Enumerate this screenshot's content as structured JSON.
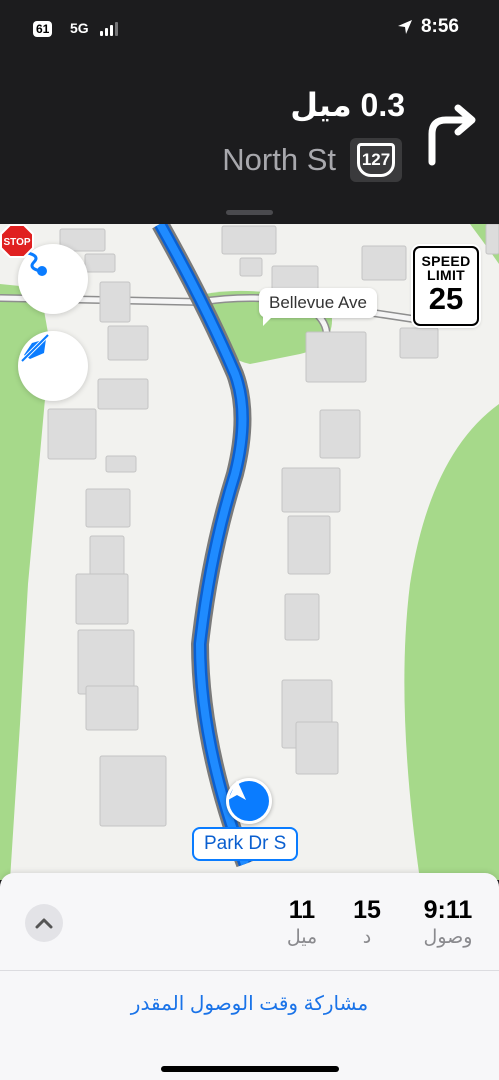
{
  "status_bar": {
    "battery": "61",
    "network": "5G",
    "time": "8:56"
  },
  "maneuver": {
    "distance": "0.3 ميل",
    "street": "North St",
    "route_shield": "127",
    "turn_icon": "turn-right-arrow-icon"
  },
  "map": {
    "speed_limit": {
      "label": "SPEED LIMIT",
      "value": "25"
    },
    "cross_street_label": "Bellevue Ave",
    "stop_sign_text": "STOP",
    "current_street": "Park Dr S",
    "buttons": {
      "routes_icon": "route-icon",
      "audio_icon": "audio-off-icon"
    },
    "colors": {
      "route": "#0a7cff",
      "park": "#a6d98a",
      "ground": "#f2f2ef"
    }
  },
  "trip": {
    "arrival_time": "9:11",
    "arrival_label": "وصول",
    "minutes": "15",
    "minutes_label": "د",
    "miles": "11",
    "miles_label": "ميل",
    "share_eta": "مشاركة وقت الوصول المقدر"
  }
}
